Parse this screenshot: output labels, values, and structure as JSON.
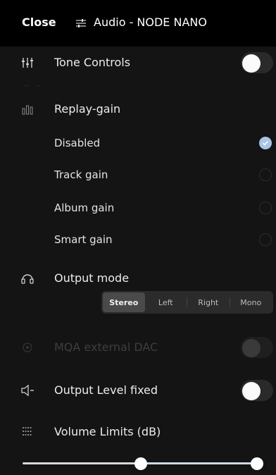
{
  "header": {
    "close_label": "Close",
    "title": "Audio - NODE NANO",
    "title_icon": "adjustments-icon"
  },
  "tone_controls": {
    "label": "Tone Controls",
    "icon": "equalizer-icon",
    "enabled": false
  },
  "replay_gain": {
    "label": "Replay-gain",
    "icon": "bars-icon",
    "options": [
      {
        "label": "Disabled",
        "selected": true
      },
      {
        "label": "Track gain",
        "selected": false
      },
      {
        "label": "Album gain",
        "selected": false
      },
      {
        "label": "Smart gain",
        "selected": false
      }
    ]
  },
  "output_mode": {
    "label": "Output mode",
    "icon": "headphones-icon",
    "segments": [
      "Stereo",
      "Left",
      "Right",
      "Mono"
    ],
    "selected": "Stereo"
  },
  "mqa": {
    "label": "MQA external DAC",
    "icon": "mqa-icon",
    "enabled": false,
    "disabled": true
  },
  "output_level_fixed": {
    "label": "Output Level fixed",
    "icon": "speaker-icon",
    "enabled": false
  },
  "volume_limits": {
    "label": "Volume Limits (dB)",
    "icon": "volume-limits-icon",
    "lower_fraction": 0.49,
    "upper_fraction": 1.0
  },
  "colors": {
    "background": "#141414",
    "accent": "#a9c4e6",
    "header": "#000000"
  }
}
